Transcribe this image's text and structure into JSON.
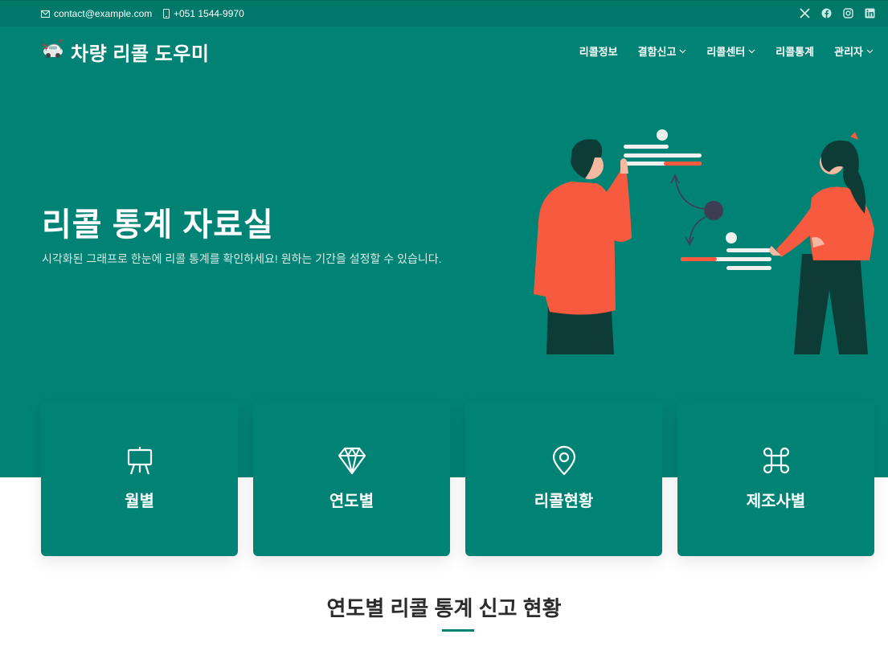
{
  "topbar": {
    "email": "contact@example.com",
    "phone": "+051 1544-9970",
    "social": [
      "x-icon",
      "facebook-icon",
      "instagram-icon",
      "linkedin-icon"
    ]
  },
  "header": {
    "brand": "차량 리콜 도우미",
    "nav": [
      {
        "label": "리콜정보",
        "dropdown": false
      },
      {
        "label": "결함신고",
        "dropdown": true
      },
      {
        "label": "리콜센터",
        "dropdown": true
      },
      {
        "label": "리콜통계",
        "dropdown": false
      },
      {
        "label": "관리자",
        "dropdown": true
      }
    ]
  },
  "hero": {
    "title": "리콜 통계 자료실",
    "subtitle": "시각화된 그래프로 한눈에 리콜 통계를 확인하세요! 원하는 기간을 설정할 수 있습니다."
  },
  "cards": [
    {
      "label": "월별",
      "icon": "easel-icon"
    },
    {
      "label": "연도별",
      "icon": "gem-icon"
    },
    {
      "label": "리콜현황",
      "icon": "map-pin-icon"
    },
    {
      "label": "제조사별",
      "icon": "command-icon"
    }
  ],
  "section": {
    "title": "연도별 리콜 통계 신고 현황"
  },
  "colors": {
    "primary": "#008374",
    "topbar": "#00796b",
    "accent": "#f85a40"
  }
}
